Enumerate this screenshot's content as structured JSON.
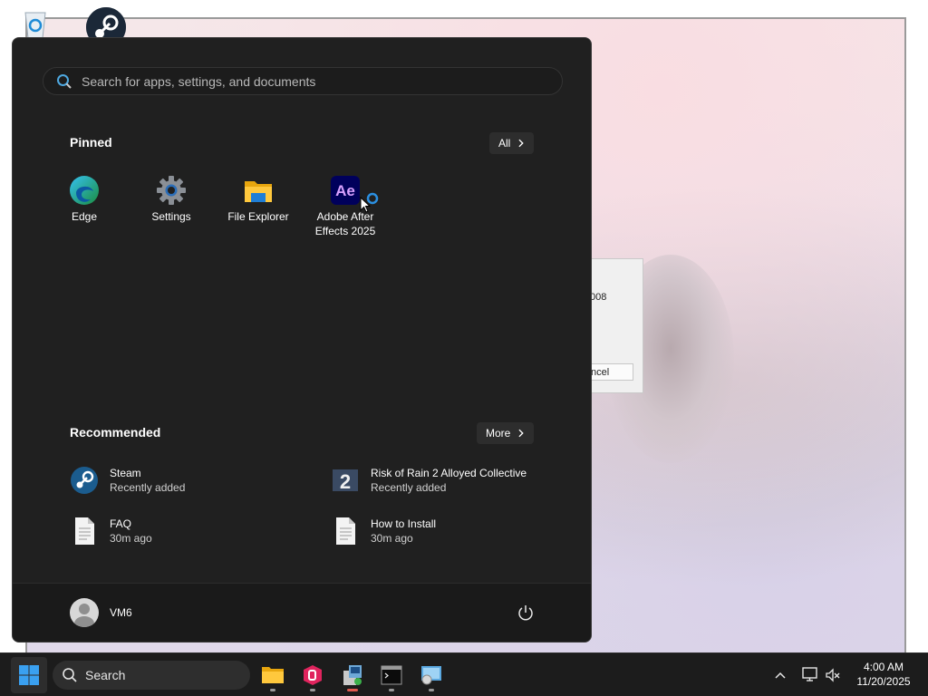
{
  "start_menu": {
    "search_placeholder": "Search for apps, settings, and documents",
    "pinned_title": "Pinned",
    "all_button": "All",
    "pinned_apps": [
      {
        "label": "Edge",
        "icon": "edge-icon"
      },
      {
        "label": "Settings",
        "icon": "settings-gear-icon"
      },
      {
        "label": "File Explorer",
        "icon": "folder-icon"
      },
      {
        "label": "Adobe After Effects 2025",
        "icon": "after-effects-icon"
      }
    ],
    "recommended_title": "Recommended",
    "more_button": "More",
    "recommended": [
      {
        "name": "Steam",
        "sub": "Recently added",
        "icon": "steam-icon"
      },
      {
        "name": "Risk of Rain 2 Alloyed Collective",
        "sub": "Recently added",
        "icon": "game-icon"
      },
      {
        "name": "FAQ",
        "sub": "30m ago",
        "icon": "document-icon"
      },
      {
        "name": "How to Install",
        "sub": "30m ago",
        "icon": "document-icon"
      }
    ],
    "user_name": "VM6"
  },
  "background_dialog": {
    "partial_text": "008",
    "button_partial": "ncel"
  },
  "taskbar": {
    "search_label": "Search",
    "apps": [
      "file-explorer-icon",
      "app-red-icon",
      "installer-icon",
      "terminal-icon",
      "disc-setup-icon"
    ],
    "time": "4:00 AM",
    "date": "11/20/2025"
  },
  "colors": {
    "menu_bg": "#202020",
    "taskbar_bg": "#1c1c1c",
    "accent": "#0078d4"
  }
}
